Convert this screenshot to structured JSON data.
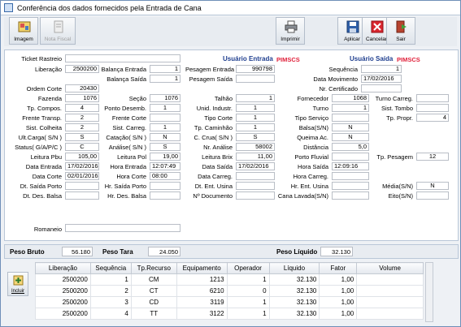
{
  "window": {
    "title": "Conferência dos dados fornecidos pela Entrada de Cana"
  },
  "toolbar": {
    "imagem": "Imagem",
    "nota_fiscal": "Nota Fiscal",
    "imprimir": "Imprimir",
    "aplicar": "Aplicar",
    "cancelar": "Cancelar",
    "sair": "Sair"
  },
  "headers": {
    "usuario_entrada": "Usuário Entrada",
    "usuario_entrada_value": "PIMSCS",
    "usuario_saida": "Usuário Saída",
    "usuario_saida_value": "PIMSCS"
  },
  "fields": {
    "ticket_rastreio": {
      "label": "Ticket Rastreio",
      "value": ""
    },
    "liberacao": {
      "label": "Liberação",
      "value": "2500200"
    },
    "balanca_entrada": {
      "label": "Balança Entrada",
      "value": "1"
    },
    "pesagem_entrada": {
      "label": "Pesagem Entrada",
      "value": "990798"
    },
    "sequencia": {
      "label": "Sequência",
      "value": "1"
    },
    "balanca_saida": {
      "label": "Balança Saída",
      "value": "1"
    },
    "pesagem_saida": {
      "label": "Pesagem Saída",
      "value": ""
    },
    "data_movimento": {
      "label": "Data Movimento",
      "value": "17/02/2016"
    },
    "ordem_corte": {
      "label": "Ordem Corte",
      "value": "20430"
    },
    "nr_certificado": {
      "label": "Nr. Certificado",
      "value": ""
    },
    "fazenda": {
      "label": "Fazenda",
      "value": "1076"
    },
    "secao": {
      "label": "Seção",
      "value": "1076"
    },
    "talhao": {
      "label": "Talhão",
      "value": "1"
    },
    "fornecedor": {
      "label": "Fornecedor",
      "value": "1068"
    },
    "turno_carreg": {
      "label": "Turno Carreg.",
      "value": ""
    },
    "tp_compos": {
      "label": "Tp. Compos.",
      "value": "4"
    },
    "ponto_desemb": {
      "label": "Ponto Desemb.",
      "value": "1"
    },
    "unid_industr": {
      "label": "Unid. Industr.",
      "value": "1"
    },
    "turno": {
      "label": "Turno",
      "value": "1"
    },
    "sist_tombo": {
      "label": "Sist. Tombo",
      "value": ""
    },
    "frente_transp": {
      "label": "Frente Transp.",
      "value": "2"
    },
    "frente_corte": {
      "label": "Frente Corte",
      "value": ""
    },
    "tipo_corte": {
      "label": "Tipo Corte",
      "value": "1"
    },
    "tipo_servico": {
      "label": "Tipo Serviço",
      "value": ""
    },
    "tp_propr": {
      "label": "Tp. Propr.",
      "value": "4"
    },
    "sist_colheita": {
      "label": "Sist. Colheita",
      "value": "2"
    },
    "sist_carreg": {
      "label": "Sist. Carreg.",
      "value": "1"
    },
    "tp_caminhao": {
      "label": "Tp. Caminhão",
      "value": "1"
    },
    "balsa": {
      "label": "Balsa(S/N)",
      "value": "N"
    },
    "ult_carga": {
      "label": "Ult.Carga( S/N )",
      "value": "S"
    },
    "catacao": {
      "label": "Catação( S/N )",
      "value": "N"
    },
    "c_crua": {
      "label": "C. Crua( S/N )",
      "value": "S"
    },
    "queima_ac": {
      "label": "Queima Ac.",
      "value": "N"
    },
    "status": {
      "label": "Status( G/A/P/C )",
      "value": "C"
    },
    "analise": {
      "label": "Análise( S/N )",
      "value": "S"
    },
    "nr_analise": {
      "label": "Nr. Análise",
      "value": "58002"
    },
    "distancia": {
      "label": "Distância",
      "value": "5,0"
    },
    "leitura_pbu": {
      "label": "Leitura Pbu",
      "value": "105,00"
    },
    "leitura_pol": {
      "label": "Leitura Pol",
      "value": "19,00"
    },
    "leitura_brix": {
      "label": "Leitura Brix",
      "value": "11,00"
    },
    "porto_fluvial": {
      "label": "Porto Fluvial",
      "value": ""
    },
    "tp_pesagem": {
      "label": "Tp. Pesagem",
      "value": "12"
    },
    "data_entrada": {
      "label": "Data Entrada",
      "value": "17/02/2016"
    },
    "hora_entrada": {
      "label": "Hora Entrada",
      "value": "12:07:49"
    },
    "data_saida": {
      "label": "Data Saída",
      "value": "17/02/2016"
    },
    "hora_saida": {
      "label": "Hora Saída",
      "value": "12:09:16"
    },
    "data_corte": {
      "label": "Data Corte",
      "value": "02/01/2016"
    },
    "hora_corte": {
      "label": "Hora Corte",
      "value": "08:00"
    },
    "data_carreg": {
      "label": "Data Carreg.",
      "value": ""
    },
    "hora_carreg": {
      "label": "Hora Carreg.",
      "value": ""
    },
    "dt_saida_porto": {
      "label": "Dt. Saída Porto",
      "value": ""
    },
    "hr_saida_porto": {
      "label": "Hr. Saída Porto",
      "value": ""
    },
    "dt_ent_usina": {
      "label": "Dt. Ent. Usina",
      "value": ""
    },
    "hr_ent_usina": {
      "label": "Hr. Ent. Usina",
      "value": ""
    },
    "media": {
      "label": "Média(S/N)",
      "value": "N"
    },
    "dt_des_balsa": {
      "label": "Dt. Des. Balsa",
      "value": ""
    },
    "hr_des_balsa": {
      "label": "Hr. Des. Balsa",
      "value": ""
    },
    "n_documento": {
      "label": "Nº Documento",
      "value": ""
    },
    "cana_lavada": {
      "label": "Cana Lavada(S/N)",
      "value": ""
    },
    "eito": {
      "label": "Eito(S/N)",
      "value": ""
    },
    "romaneio": {
      "label": "Romaneio",
      "value": ""
    }
  },
  "totals": {
    "peso_bruto_label": "Peso Bruto",
    "peso_bruto": "56.180",
    "peso_tara_label": "Peso Tara",
    "peso_tara": "24.050",
    "peso_liquido_label": "Peso Líquido",
    "peso_liquido": "32.130"
  },
  "incluir": "Incluir",
  "grid": {
    "columns": [
      "Liberação",
      "Sequência",
      "Tp.Recurso",
      "Equipamento",
      "Operador",
      "Líquido",
      "Fator",
      "Volume"
    ],
    "rows": [
      [
        "2500200",
        "1",
        "CM",
        "1213",
        "1",
        "32.130",
        "1,00",
        ""
      ],
      [
        "2500200",
        "2",
        "CT",
        "6210",
        "0",
        "32.130",
        "1,00",
        ""
      ],
      [
        "2500200",
        "3",
        "CD",
        "3119",
        "1",
        "32.130",
        "1,00",
        ""
      ],
      [
        "2500200",
        "4",
        "TT",
        "3122",
        "1",
        "32.130",
        "1,00",
        ""
      ]
    ]
  },
  "colors": {
    "title_blue": "#1f3f8f",
    "user_red": "#e0203a",
    "border": "#b9c7d8"
  }
}
